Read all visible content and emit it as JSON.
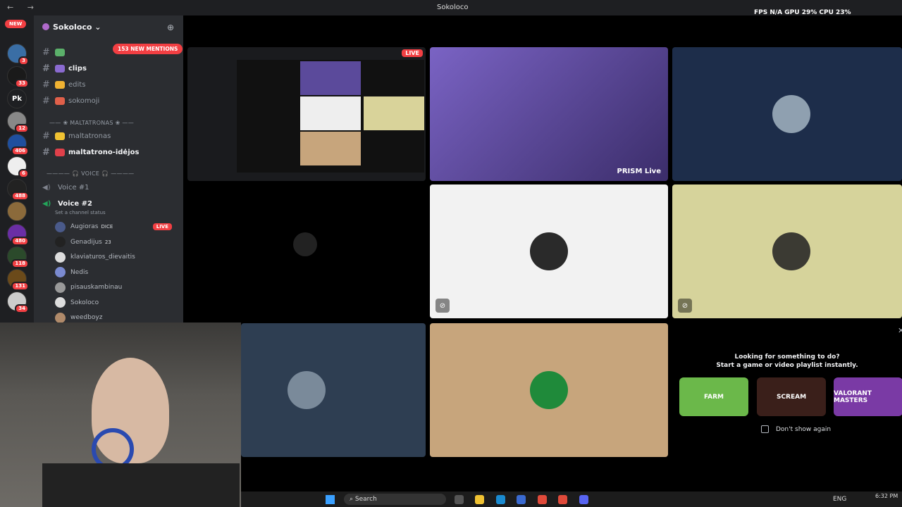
{
  "window": {
    "title": "Sokoloco",
    "nav": "← →"
  },
  "perf": "FPS N/A   GPU 29%   CPU 23%",
  "servers": {
    "new_label": "NEW",
    "items": [
      {
        "label": "",
        "badge": "3",
        "color": "#3a6ea5"
      },
      {
        "label": "",
        "badge": "33",
        "color": "#1a1a1a"
      },
      {
        "label": "Pk",
        "badge": "",
        "color": "#1e1f22"
      },
      {
        "label": "",
        "badge": "12",
        "color": "#888"
      },
      {
        "label": "",
        "badge": "406",
        "color": "#1f4f9e"
      },
      {
        "label": "",
        "badge": "6",
        "color": "#eee"
      },
      {
        "label": "",
        "badge": "488",
        "color": "#222"
      },
      {
        "label": "",
        "badge": "",
        "color": "#8b6a3b"
      },
      {
        "label": "",
        "badge": "480",
        "color": "#6a2ea5"
      },
      {
        "label": "",
        "badge": "118",
        "color": "#2b4a2b"
      },
      {
        "label": "",
        "badge": "131",
        "color": "#6b4a1a"
      },
      {
        "label": "",
        "badge": "34",
        "color": "#ccc"
      }
    ]
  },
  "sidebar": {
    "server_name": "Sokoloco",
    "mentions": "153 NEW MENTIONS",
    "channels": [
      {
        "label": "",
        "emoji_color": "#5bb06a",
        "bright": false
      },
      {
        "label": "clips",
        "emoji_color": "#8a6ad0",
        "bright": true
      },
      {
        "label": "edits",
        "emoji_color": "#f0b232",
        "bright": false
      },
      {
        "label": "sokomoji",
        "emoji_color": "#e0604a",
        "bright": false
      }
    ],
    "category_1": "MALTATRONAS",
    "channels_2": [
      {
        "label": "maltatronas",
        "emoji_color": "#f0c232",
        "bright": false
      },
      {
        "label": "maltatrono-idėjos",
        "emoji_color": "#e0404a",
        "bright": true
      }
    ],
    "category_2": "VOICE",
    "voice_1": "Voice #1",
    "voice_2": "Voice #2",
    "channel_status": "Set a channel status",
    "members": [
      {
        "name": "Augioras",
        "extra": "DICE",
        "live": "LIVE",
        "color": "#4a5a8a"
      },
      {
        "name": "Genadijus",
        "extra": "23",
        "live": "",
        "color": "#222"
      },
      {
        "name": "klaviaturos_dievaitis",
        "extra": "",
        "live": "",
        "color": "#ddd"
      },
      {
        "name": "Nedis",
        "extra": "",
        "live": "",
        "color": "#7a8ad0"
      },
      {
        "name": "pisauskambinau",
        "extra": "",
        "live": "",
        "color": "#999"
      },
      {
        "name": "Sokoloco",
        "extra": "",
        "live": "",
        "color": "#ddd"
      },
      {
        "name": "weedboyz",
        "extra": "",
        "live": "",
        "color": "#b08a6a"
      }
    ]
  },
  "tiles": {
    "live_label": "LIVE",
    "prism_label": "PRISM Live"
  },
  "activity": {
    "line1": "Looking for something to do?",
    "line2": "Start a game or video playlist instantly.",
    "games": [
      "FARM",
      "SCREAM",
      "VALORANT MASTERS"
    ],
    "dont_show": "Don't show again"
  },
  "taskbar": {
    "search": "Search",
    "lang": "ENG",
    "time": "6:32 PM"
  }
}
